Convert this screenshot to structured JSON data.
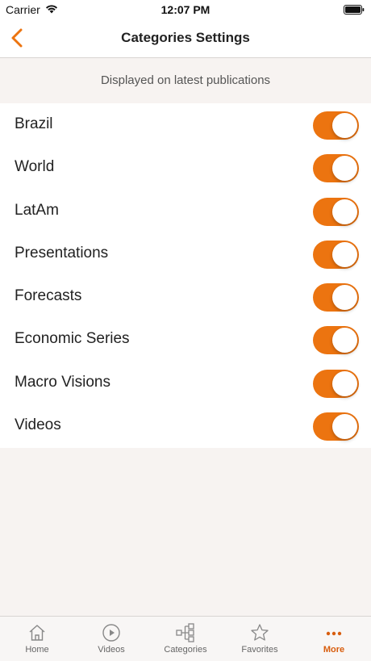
{
  "status_bar": {
    "carrier": "Carrier",
    "time": "12:07 PM"
  },
  "nav": {
    "title": "Categories Settings",
    "back_icon": "chevron-left-icon"
  },
  "section": {
    "header": "Displayed on latest publications"
  },
  "categories": [
    {
      "label": "Brazil",
      "enabled": true
    },
    {
      "label": "World",
      "enabled": true
    },
    {
      "label": "LatAm",
      "enabled": true
    },
    {
      "label": "Presentations",
      "enabled": true
    },
    {
      "label": "Forecasts",
      "enabled": true
    },
    {
      "label": "Economic Series",
      "enabled": true
    },
    {
      "label": "Macro Visions",
      "enabled": true
    },
    {
      "label": "Videos",
      "enabled": true
    }
  ],
  "tabs": [
    {
      "label": "Home",
      "icon": "home-icon",
      "active": false
    },
    {
      "label": "Videos",
      "icon": "play-circle-icon",
      "active": false
    },
    {
      "label": "Categories",
      "icon": "hierarchy-icon",
      "active": false
    },
    {
      "label": "Favorites",
      "icon": "star-icon",
      "active": false
    },
    {
      "label": "More",
      "icon": "more-dots-icon",
      "active": true
    }
  ],
  "colors": {
    "accent": "#ec7410",
    "active_tab": "#d85d0e",
    "background": "#f7f3f1"
  }
}
